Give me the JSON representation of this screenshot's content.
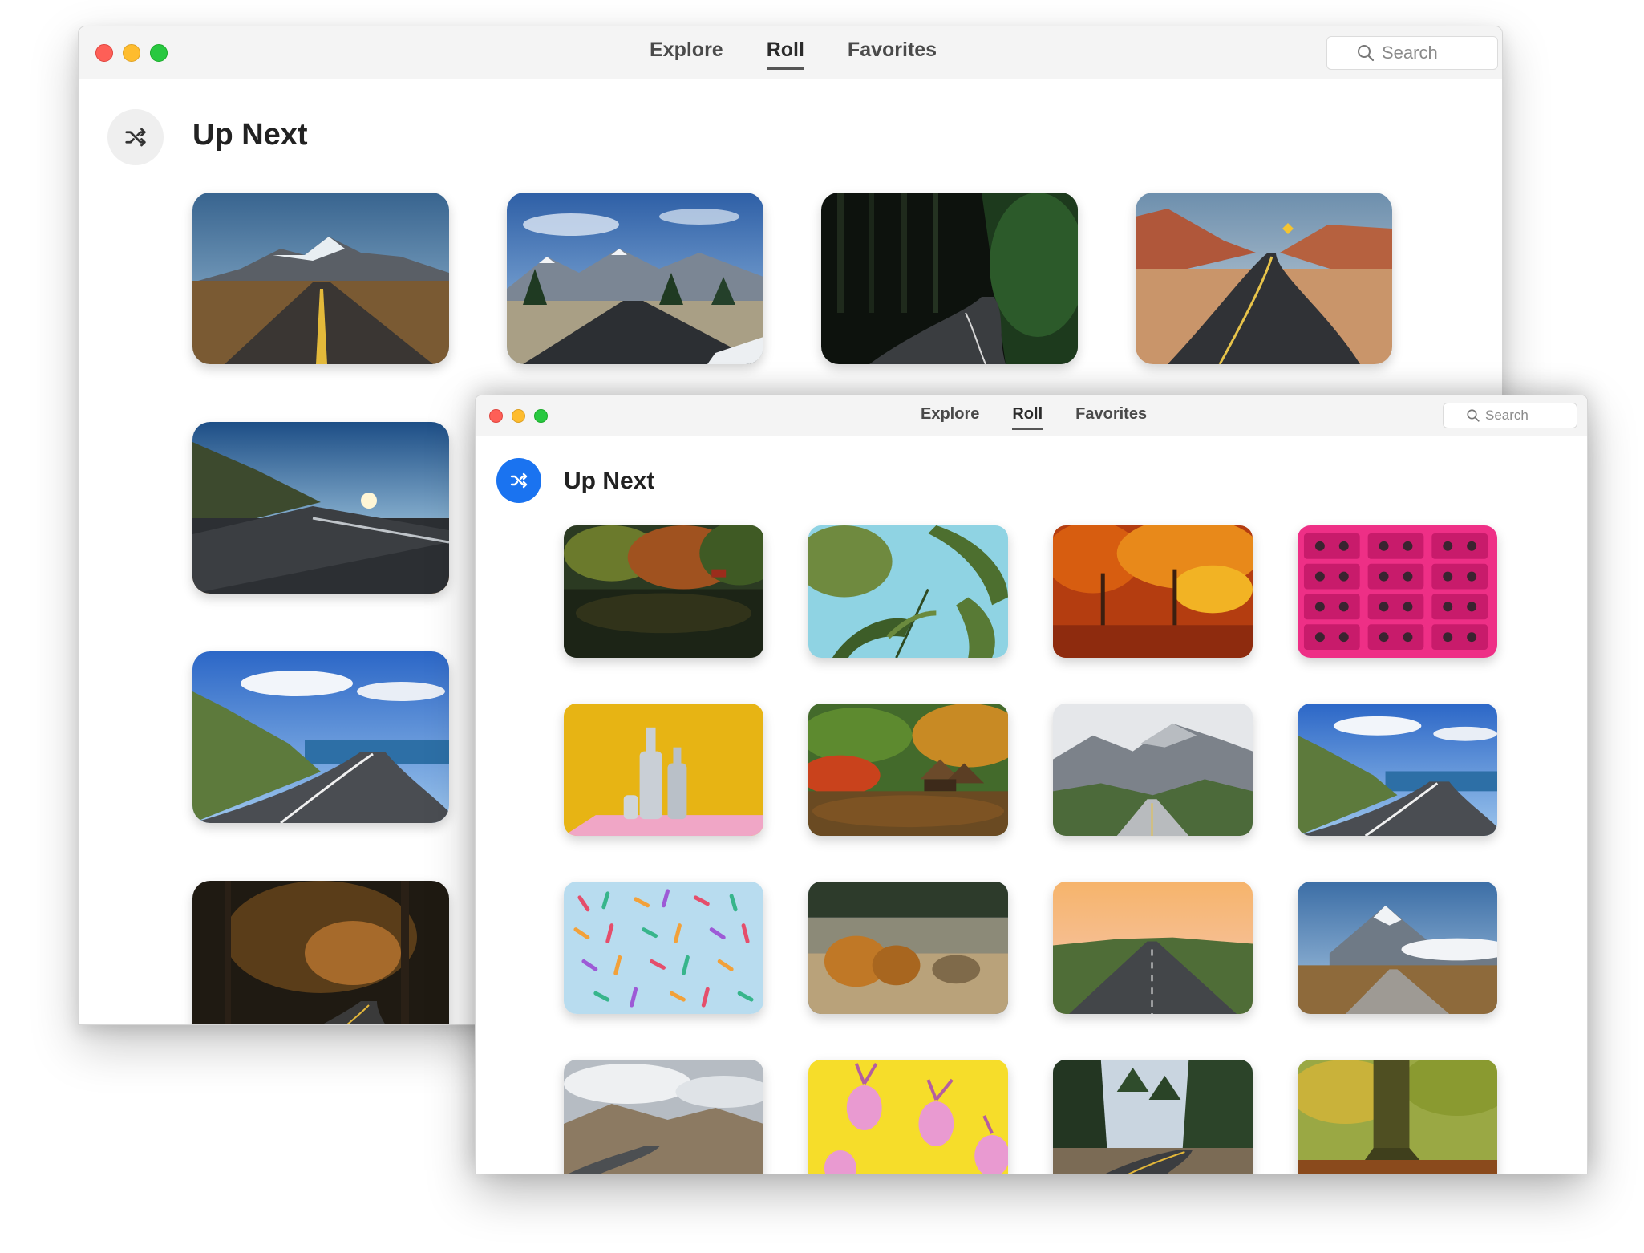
{
  "back_window": {
    "tabs": [
      {
        "label": "Explore",
        "active": false
      },
      {
        "label": "Roll",
        "active": true
      },
      {
        "label": "Favorites",
        "active": false
      }
    ],
    "search_placeholder": "Search",
    "section_title": "Up Next",
    "shuffle_icon": "shuffle-icon",
    "photos": [
      "road-mountains-desert",
      "road-snowy-mountains-pines",
      "road-dark-forest",
      "road-red-desert-canyon",
      "road-sunset-hills",
      "road-coast-sea",
      "road-autumn-forest"
    ]
  },
  "front_window": {
    "tabs": [
      {
        "label": "Explore",
        "active": false
      },
      {
        "label": "Roll",
        "active": true
      },
      {
        "label": "Favorites",
        "active": false
      }
    ],
    "search_placeholder": "Search",
    "section_title": "Up Next",
    "shuffle_icon": "shuffle-icon",
    "accent_color": "#1a73f0",
    "photos": [
      "autumn-lake-reflection",
      "tropical-leaves-blue",
      "autumn-red-trees",
      "pink-cassette-tapes",
      "white-bottles-yellow",
      "autumn-lake-huts",
      "road-mountain-valley",
      "road-coast-sea",
      "colorful-clothespins",
      "autumn-shrubs-field",
      "road-peach-sky",
      "road-snowy-peak-clouds",
      "road-rocky-hills-clouds",
      "pink-pineapples-yellow",
      "road-pine-forest",
      "forest-big-tree"
    ]
  },
  "colors": {
    "close": "#fe5f57",
    "minimize": "#febc2e",
    "maximize": "#28c840",
    "titlebar": "#f4f4f4"
  }
}
